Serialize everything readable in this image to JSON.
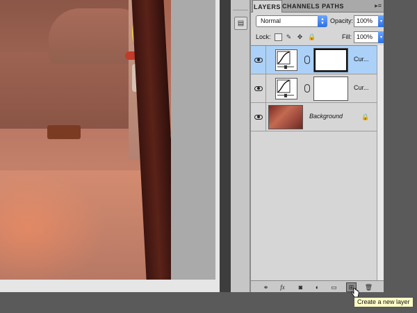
{
  "panel": {
    "tabs": [
      {
        "label": "LAYERS",
        "active": true
      },
      {
        "label": "CHANNELS",
        "active": false
      },
      {
        "label": "PATHS",
        "active": false
      }
    ],
    "menu_glyph": "▸≡",
    "blend_mode": "Normal",
    "opacity_label": "Opacity:",
    "opacity_value": "100%",
    "lock_label": "Lock:",
    "fill_label": "Fill:",
    "fill_value": "100%"
  },
  "layers": [
    {
      "name": "Cur...",
      "type": "curves-adjustment",
      "selected": true,
      "visible": true
    },
    {
      "name": "Cur...",
      "type": "curves-adjustment",
      "selected": false,
      "visible": true
    },
    {
      "name": "Background",
      "type": "image",
      "selected": false,
      "visible": true,
      "locked": true
    }
  ],
  "bottom_bar": {
    "buttons": [
      {
        "icon": "link-layers-icon",
        "glyph": "⚭"
      },
      {
        "icon": "fx-icon",
        "glyph": "fx"
      },
      {
        "icon": "add-mask-icon",
        "glyph": "◙"
      },
      {
        "icon": "adjustment-layer-icon",
        "glyph": "◐"
      },
      {
        "icon": "group-folder-icon",
        "glyph": "▭"
      },
      {
        "icon": "new-layer-icon",
        "glyph": "⊞"
      },
      {
        "icon": "trash-icon",
        "glyph": "🗑"
      }
    ]
  },
  "tooltip": {
    "text": "Create a new layer"
  },
  "colors": {
    "selected_row": "#acd1f8",
    "panel_bg": "#d6d6d6",
    "tooltip_bg": "#fffdc6"
  }
}
